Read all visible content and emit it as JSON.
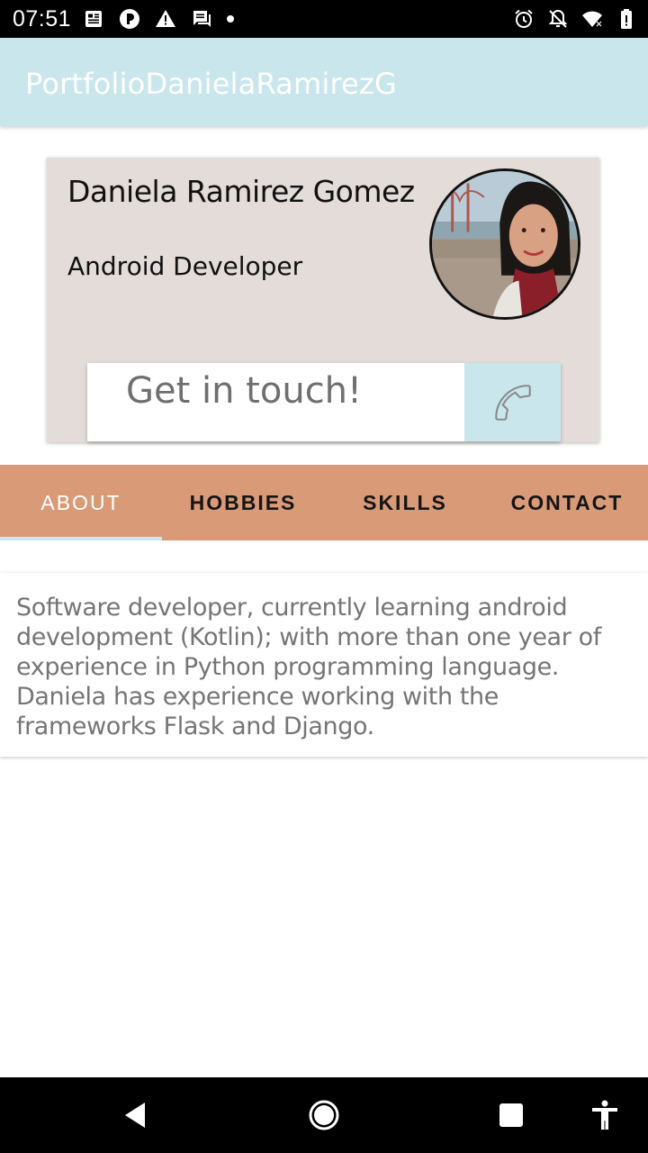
{
  "status_bar": {
    "time": "07:51",
    "left_icons": [
      "news-icon",
      "podcast-icon",
      "warning-icon",
      "messages-icon",
      "dot-icon"
    ],
    "right_icons": [
      "alarm-icon",
      "notifications-off-icon",
      "wifi-icon",
      "battery-icon"
    ]
  },
  "app_bar": {
    "title": "PortfolioDanielaRamirezG",
    "color": "#c9e6ed"
  },
  "profile": {
    "name": "Daniela Ramirez Gomez",
    "role": "Android Developer",
    "avatar_icon": "profile-photo",
    "contact_label": "Get in touch!",
    "contact_icon": "phone-icon",
    "card_color": "#e3dcd8"
  },
  "tabs": {
    "items": [
      {
        "label": "ABOUT",
        "active": true
      },
      {
        "label": "HOBBIES",
        "active": false
      },
      {
        "label": "SKILLS",
        "active": false
      },
      {
        "label": "CONTACT",
        "active": false
      }
    ],
    "bar_color": "#d99a77",
    "indicator_color": "#c9e6ed"
  },
  "about": {
    "text": "Software developer, currently learning android development (Kotlin); with more than one year of experience in Python programming language. Daniela has experience working with the frameworks Flask and Django."
  },
  "nav_bar": {
    "icons": [
      "back-icon",
      "home-icon",
      "recents-icon",
      "accessibility-icon"
    ]
  }
}
